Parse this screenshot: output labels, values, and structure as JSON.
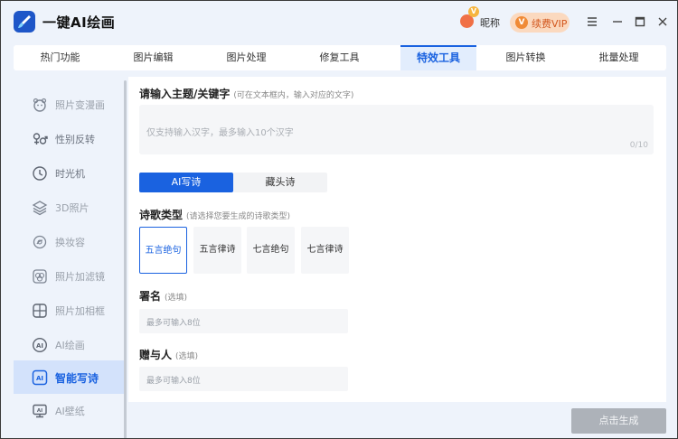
{
  "app": {
    "title": "一键AI绘画",
    "logo_icon": "brush-icon"
  },
  "user": {
    "nickname": "昵称",
    "badge": "V",
    "vip_button": "续费VIP",
    "vip_badge": "V"
  },
  "nav": {
    "tabs": [
      {
        "label": "热门功能"
      },
      {
        "label": "图片编辑"
      },
      {
        "label": "图片处理"
      },
      {
        "label": "修复工具"
      },
      {
        "label": "特效工具"
      },
      {
        "label": "图片转换"
      },
      {
        "label": "批量处理"
      }
    ],
    "active_index": 4
  },
  "sidebar": {
    "items": [
      {
        "label": "照片变漫画",
        "icon": "cartoon-face-icon"
      },
      {
        "label": "性别反转",
        "icon": "gender-icon"
      },
      {
        "label": "时光机",
        "icon": "clock-icon"
      },
      {
        "label": "3D照片",
        "icon": "layers-icon"
      },
      {
        "label": "换妆容",
        "icon": "makeup-icon"
      },
      {
        "label": "照片加滤镜",
        "icon": "filter-icon"
      },
      {
        "label": "照片加相框",
        "icon": "frame-icon"
      },
      {
        "label": "AI绘画",
        "icon": "ai-circle-icon"
      },
      {
        "label": "智能写诗",
        "icon": "ai-square-icon"
      },
      {
        "label": "AI壁纸",
        "icon": "monitor-icon"
      }
    ],
    "active_index": 8
  },
  "main": {
    "topic": {
      "title": "请输入主题/关键字",
      "hint": "(可在文本框内，输入对应的文字)",
      "placeholder": "仅支持输入汉字，最多输入10个汉字",
      "counter": "0/10"
    },
    "modes": {
      "ai_poem": "AI写诗",
      "acrostic": "藏头诗"
    },
    "poem_type": {
      "title": "诗歌类型",
      "hint": "(请选择您要生成的诗歌类型)",
      "options": [
        "五言绝句",
        "五言律诗",
        "七言绝句",
        "七言律诗"
      ],
      "selected_index": 0
    },
    "signature": {
      "title": "署名",
      "hint": "(选填)",
      "placeholder": "最多可输入8位"
    },
    "recipient": {
      "title": "赠与人",
      "hint": "(选填)",
      "placeholder": "最多可输入8位"
    }
  },
  "generate_button": "点击生成",
  "colors": {
    "accent": "#1a62e0",
    "vip": "#f08a36",
    "disabled": "#adb2b9"
  }
}
